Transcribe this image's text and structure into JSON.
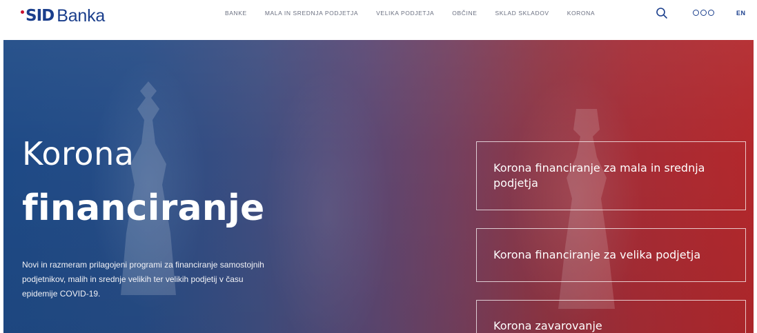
{
  "header": {
    "logo_mark": "SID",
    "logo_text": "Banka",
    "nav": [
      {
        "label": "BANKE"
      },
      {
        "label": "MALA IN SREDNJA PODJETJA"
      },
      {
        "label": "VELIKA PODJETJA"
      },
      {
        "label": "OBČINE"
      },
      {
        "label": "SKLAD SKLADOV"
      },
      {
        "label": "KORONA"
      }
    ],
    "search_icon": "search-icon",
    "menu_icon": "dots-menu-icon",
    "language": "EN"
  },
  "hero": {
    "title_light": "Korona",
    "title_bold": "financiranje",
    "description": "Novi in razmeram prilagojeni programi za financiranje samostojnih podjetnikov, malih in srednje velikih ter velikih podjetij v času epidemije COVID-19.",
    "cards": [
      {
        "label": "Korona financiranje za mala in srednja podjetja"
      },
      {
        "label": "Korona financiranje za velika podjetja"
      },
      {
        "label": "Korona zavarovanje"
      }
    ]
  },
  "colors": {
    "brand_blue": "#1a3e8c",
    "brand_red": "#c8102e",
    "nav_text": "#6a6f80",
    "hero_left": "#1e4a86",
    "hero_right": "#b3282c"
  }
}
